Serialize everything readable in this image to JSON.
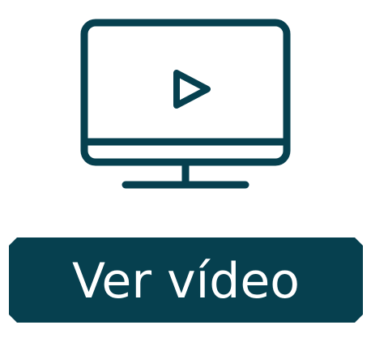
{
  "icon": {
    "name": "monitor-play-icon",
    "color": "#06404f"
  },
  "button": {
    "label": "Ver vídeo",
    "background": "#06404f",
    "text_color": "#ffffff"
  }
}
